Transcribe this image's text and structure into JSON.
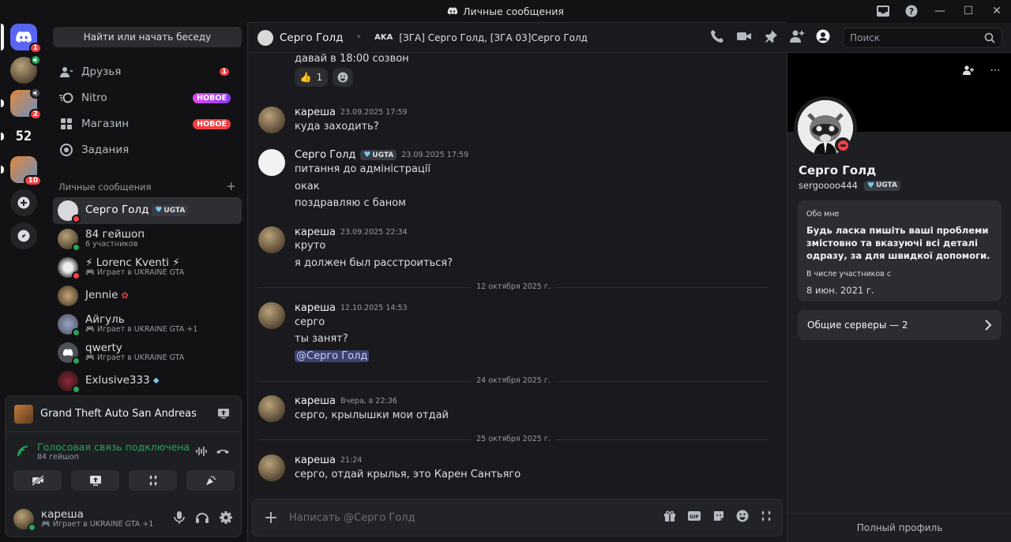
{
  "window": {
    "title": "Личные сообщения"
  },
  "rail": {
    "home_badge": "1",
    "gta_badge": "2",
    "srv52_label": "52",
    "gta2_badge": "10"
  },
  "sidebar": {
    "search_label": "Найти или начать беседу",
    "nav": [
      {
        "label": "Друзья",
        "badge": "1"
      },
      {
        "label": "Nitro",
        "tag": "НОВОЕ"
      },
      {
        "label": "Магазин",
        "tag": "НОВОЕ"
      },
      {
        "label": "Задания"
      }
    ],
    "dm_header": "Личные сообщения",
    "dm_header_plus": "+",
    "dms": [
      {
        "name": "Серго Голд",
        "tag": "UGTA",
        "sub": ""
      },
      {
        "name": "84 гейшоп",
        "sub": "6 участников"
      },
      {
        "name": "⚡ Lorenc Kventi ⚡",
        "sub": "Играет в UKRAINE GTA"
      },
      {
        "name": "Jennie",
        "sub": ""
      },
      {
        "name": "Айгуль",
        "sub": "Играет в UKRAINE GTA",
        "extra": "+1"
      },
      {
        "name": "qwerty",
        "sub": "Играет в UKRAINE GTA"
      },
      {
        "name": "Exlusive333",
        "sub": ""
      }
    ]
  },
  "panel": {
    "game": "Grand Theft Auto San Andreas",
    "voice_title": "Голосовая связь подключена",
    "voice_channel": "84 гейшоп",
    "user_name": "кареша",
    "user_status": "Играет в UKRAINE GTA",
    "user_status_extra": "+1"
  },
  "chat": {
    "header_name": "Серго Голд",
    "aka_label": "AKA",
    "aka_names": "[ЗГА] Серго Голд, [ЗГА 03]Серго Голд",
    "search_placeholder": "Поиск",
    "composer_placeholder": "Написать @Серго Голд",
    "top_line": "давай в 18:00 созвон",
    "reaction_count": "1",
    "reaction_emoji": "👍",
    "messages": [
      {
        "author": "кареша",
        "time": "23.09.2025 17:59",
        "lines": [
          "куда заходить?"
        ]
      },
      {
        "author": "Серго Голд",
        "tag": "UGTA",
        "time": "23.09.2025 17:59",
        "lines": [
          "питання до адміністрації",
          "окак",
          "поздравляю с баном"
        ]
      },
      {
        "author": "кареша",
        "time": "23.09.2025 22:34",
        "lines": [
          "круто",
          "я должен был расстроиться?"
        ]
      },
      {
        "author": "кареша",
        "time": "12.10.2025 14:53",
        "lines": [
          "серго",
          "ты занят?",
          "@Серго Голд"
        ]
      },
      {
        "author": "кареша",
        "time": "Вчера, в 22:36",
        "lines": [
          "серго, крылышки мои отдай"
        ]
      },
      {
        "author": "кареша",
        "time": "21:24",
        "lines": [
          "серго, отдай крылья, это Карен Сантьяго"
        ]
      }
    ],
    "dividers": [
      "12 октября 2025 г.",
      "24 октября 2025 г.",
      "25 октября 2025 г."
    ]
  },
  "profile": {
    "name": "Серго Голд",
    "username": "sergoooo444",
    "tag": "UGTA",
    "about_label": "Обо мне",
    "about_text": "Будь ласка пишіть ваші проблеми змістовно та вказуючі всі деталі одразу, за для швидкої допомоги.",
    "member_since_label": "В числе участников с",
    "member_since": "8 июн. 2021 г.",
    "mutual_servers": "Общие серверы — 2",
    "full_profile": "Полный профиль",
    "more": "⋯"
  },
  "colors": {
    "accent": "#5865f2",
    "online": "#23a55a",
    "dnd": "#f23f43"
  }
}
